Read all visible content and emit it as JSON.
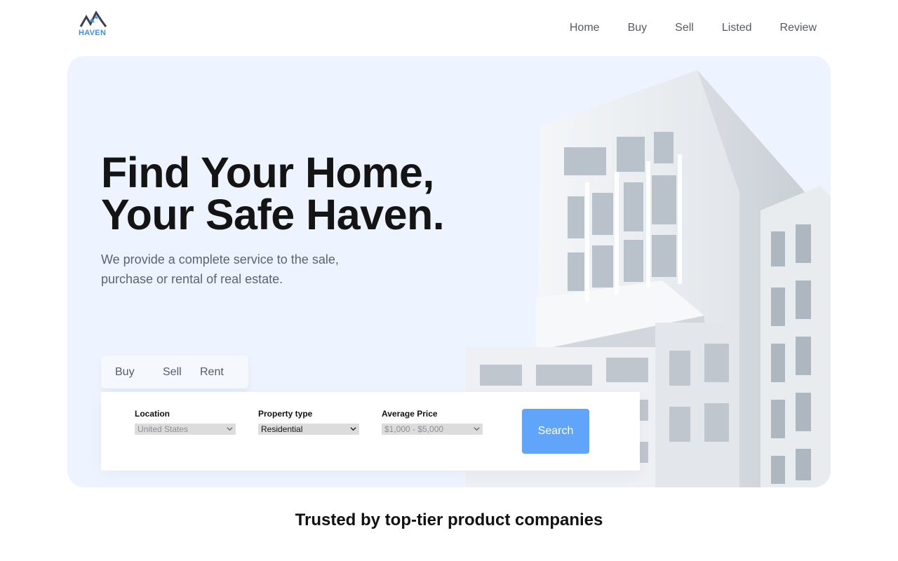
{
  "brand": {
    "name": "HAVEN",
    "accent": "#3d8ef0"
  },
  "nav": {
    "items": [
      "Home",
      "Buy",
      "Sell",
      "Listed",
      "Review"
    ]
  },
  "hero": {
    "title_line1": "Find Your Home,",
    "title_line2": "Your Safe Haven.",
    "subtitle_line1": "We provide a complete service to the sale,",
    "subtitle_line2": "purchase or rental of real estate.",
    "background": "#eef4ff"
  },
  "search": {
    "tabs": [
      "Buy",
      "Sell",
      "Rent"
    ],
    "fields": [
      {
        "label": "Location",
        "value": "United States"
      },
      {
        "label": "Property type",
        "value": "Residential"
      },
      {
        "label": "Average Price",
        "value": "$1,000 - $5,000"
      }
    ],
    "button_label": "Search",
    "button_color": "#60a5fa"
  },
  "trusted": {
    "heading": "Trusted by top-tier product companies"
  }
}
